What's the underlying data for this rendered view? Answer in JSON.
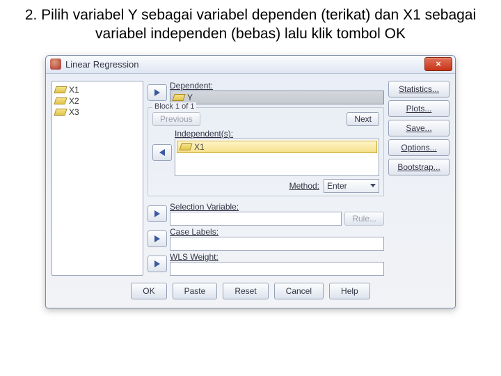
{
  "instruction": "2. Pilih variabel Y sebagai variabel dependen (terikat) dan X1 sebagai variabel independen (bebas) lalu klik tombol OK",
  "dialog": {
    "title": "Linear Regression",
    "close": "×",
    "varlist": [
      "X1",
      "X2",
      "X3"
    ],
    "dependent_label": "Dependent:",
    "dependent_value": "Y",
    "block_title": "Block 1 of 1",
    "previous": "Previous",
    "next": "Next",
    "independent_label": "Independent(s):",
    "independent_items": [
      "X1"
    ],
    "method_label": "Method:",
    "method_value": "Enter",
    "selection_label": "Selection Variable:",
    "rule": "Rule...",
    "case_label": "Case Labels:",
    "wls_label": "WLS Weight:",
    "side": {
      "statistics": "Statistics...",
      "plots": "Plots...",
      "save": "Save...",
      "options": "Options...",
      "bootstrap": "Bootstrap..."
    },
    "footer": {
      "ok": "OK",
      "paste": "Paste",
      "reset": "Reset",
      "cancel": "Cancel",
      "help": "Help"
    }
  }
}
